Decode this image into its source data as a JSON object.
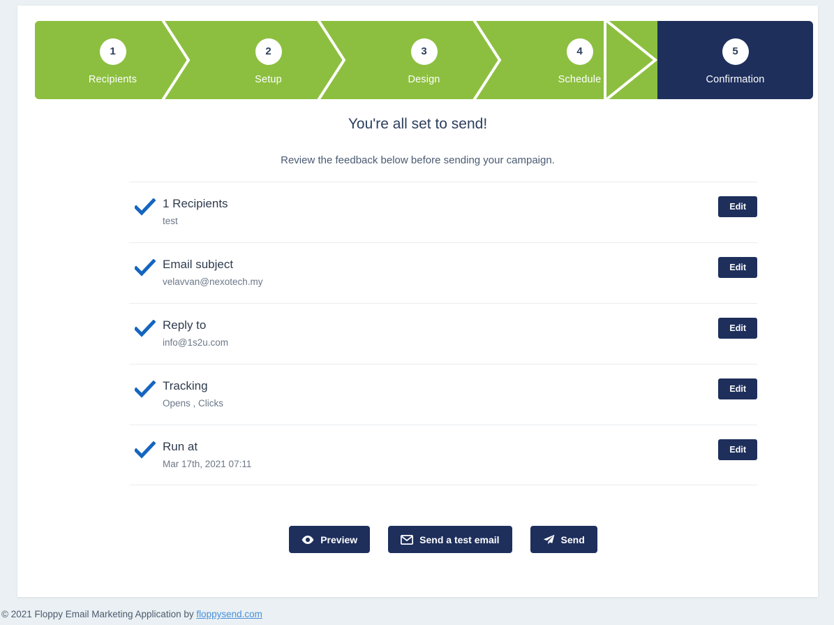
{
  "stepper": {
    "steps": [
      {
        "number": "1",
        "label": "Recipients",
        "state": "done"
      },
      {
        "number": "2",
        "label": "Setup",
        "state": "done"
      },
      {
        "number": "3",
        "label": "Design",
        "state": "done"
      },
      {
        "number": "4",
        "label": "Schedule",
        "state": "done"
      },
      {
        "number": "5",
        "label": "Confirmation",
        "state": "active"
      }
    ],
    "colors": {
      "done": "#8cbf3f",
      "active": "#1e2f5c",
      "circle": "#ffffff",
      "label": "#ffffff"
    }
  },
  "headings": {
    "title": "You're all set to send!",
    "subtitle": "Review the feedback below before sending your campaign."
  },
  "summary": {
    "edit_label": "Edit",
    "check_color": "#1565c0",
    "rows": [
      {
        "title": "1 Recipients",
        "value": "test"
      },
      {
        "title": "Email subject",
        "value": "velavvan@nexotech.my"
      },
      {
        "title": "Reply to",
        "value": "info@1s2u.com"
      },
      {
        "title": "Tracking",
        "value": "Opens , Clicks"
      },
      {
        "title": "Run at",
        "value": "Mar 17th, 2021 07:11"
      }
    ]
  },
  "actions": {
    "preview": {
      "label": "Preview",
      "icon": "eye-icon"
    },
    "send_test": {
      "label": "Send a test email",
      "icon": "envelope-icon"
    },
    "send": {
      "label": "Send",
      "icon": "paper-plane-icon"
    }
  },
  "footer": {
    "text": "© 2021 Floppy Email Marketing Application by ",
    "link": "floppysend.com",
    "link_color": "#4a90d9"
  }
}
